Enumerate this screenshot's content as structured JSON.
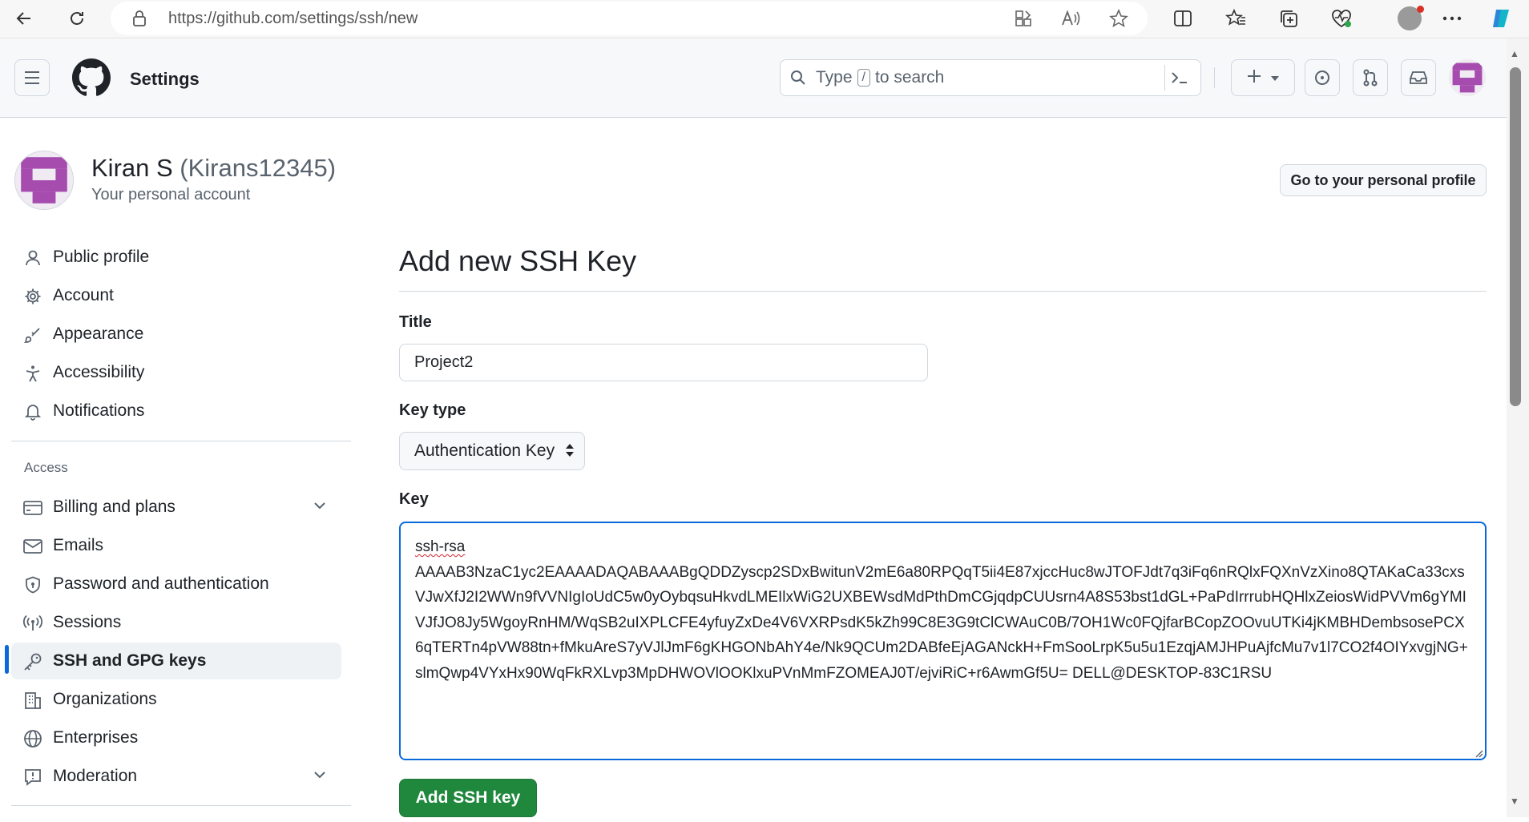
{
  "browser": {
    "url": "https://github.com/settings/ssh/new"
  },
  "header": {
    "context_title": "Settings",
    "search_placeholder_prefix": "Type",
    "search_placeholder_key": "/",
    "search_placeholder_suffix": "to search"
  },
  "profile": {
    "display_name": "Kiran S",
    "login": "(Kirans12345)",
    "subtitle": "Your personal account",
    "profile_button": "Go to your personal profile"
  },
  "sidebar": {
    "items_top": [
      {
        "label": "Public profile",
        "icon": "person-icon"
      },
      {
        "label": "Account",
        "icon": "gear-icon"
      },
      {
        "label": "Appearance",
        "icon": "paintbrush-icon"
      },
      {
        "label": "Accessibility",
        "icon": "accessibility-icon"
      },
      {
        "label": "Notifications",
        "icon": "bell-icon"
      }
    ],
    "section_access": "Access",
    "items_access": [
      {
        "label": "Billing and plans",
        "icon": "credit-card-icon"
      },
      {
        "label": "Emails",
        "icon": "mail-icon"
      },
      {
        "label": "Password and authentication",
        "icon": "shield-lock-icon"
      },
      {
        "label": "Sessions",
        "icon": "broadcast-icon"
      },
      {
        "label": "SSH and GPG keys",
        "icon": "key-icon"
      },
      {
        "label": "Organizations",
        "icon": "organization-icon"
      },
      {
        "label": "Enterprises",
        "icon": "globe-icon"
      },
      {
        "label": "Moderation",
        "icon": "report-icon"
      }
    ]
  },
  "form": {
    "page_title": "Add new SSH Key",
    "title_label": "Title",
    "title_value": "Project2",
    "key_type_label": "Key type",
    "key_type_value": "Authentication Key",
    "key_label": "Key",
    "key_value_first": "ssh-rsa",
    "key_value_rest": "AAAAB3NzaC1yc2EAAAADAQABAAABgQDDZyscp2SDxBwitunV2mE6a80RPQqT5ii4E87xjccHuc8wJTOFJdt7q3iFq6nRQlxFQXnVzXino8QTAKaCa33cxsVJwXfJ2I2WWn9fVVNIgIoUdC5w0yOybqsuHkvdLMEIlxWiG2UXBEWsdMdPthDmCGjqdpCUUsrn4A8S53bst1dGL+PaPdIrrrubHQHlxZeiosWidPVVm6gYMIVJfJO8Jy5WgoyRnHM/WqSB2uIXPLCFE4yfuyZxDe4V6VXRPsdK5kZh99C8E3G9tClCWAuC0B/7OH1Wc0FQjfarBCopZOOvuUTKi4jKMBHDembsosePCX6qTERTn4pVW88tn+fMkuAreS7yVJlJmF6gKHGONbAhY4e/Nk9QCUm2DABfeEjAGANckH+FmSooLrpK5u5u1EzqjAMJHPuAjfcMu7v1l7CO2f4OIYxvgjNG+slmQwp4VYxHx90WqFkRXLvp3MpDHWOVlOOKlxuPVnMmFZOMEAJ0T/ejviRiC+r6AwmGf5U= DELL@DESKTOP-83C1RSU",
    "submit_label": "Add SSH key"
  },
  "colors": {
    "accent": "#0969da",
    "primary_button": "#1f883d",
    "border": "#d0d7de",
    "muted_text": "#59636e"
  }
}
